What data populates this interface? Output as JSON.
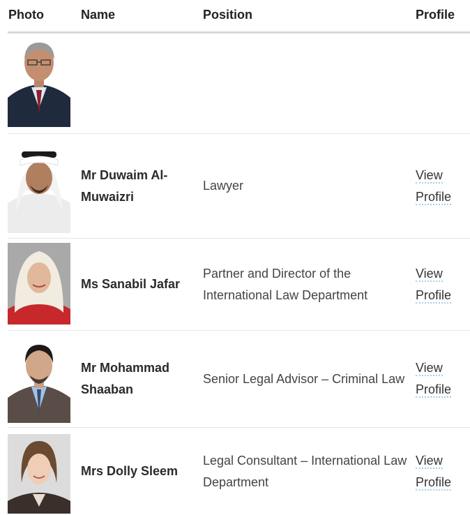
{
  "table": {
    "headers": {
      "photo": "Photo",
      "name": "Name",
      "position": "Position",
      "profile": "Profile"
    },
    "rows": [
      {
        "name": "",
        "position": "",
        "profile": ""
      },
      {
        "name": "Mr Duwaim Al-Muwaizri",
        "position": "Lawyer",
        "profile": "View Profile"
      },
      {
        "name": "Ms Sanabil Jafar",
        "position": "Partner and Director of the International Law Department",
        "profile": "View Profile"
      },
      {
        "name": "Mr Mohammad Shaaban",
        "position": "Senior Legal Advisor – Criminal Law",
        "profile": "View Profile"
      },
      {
        "name": "Mrs Dolly Sleem",
        "position": "Legal Consultant – International Law Department",
        "profile": "View Profile"
      }
    ]
  },
  "colors": {
    "header_border": "#d8d8d8",
    "row_border": "#e6e6e6",
    "link_underline": "#9fd2e6"
  },
  "icons": {
    "photo_1": "man-in-suit-portrait",
    "photo_2": "man-in-ghutra-portrait",
    "photo_3": "woman-in-hijab-portrait",
    "photo_4": "man-in-suit-portrait",
    "photo_5": "woman-portrait"
  }
}
